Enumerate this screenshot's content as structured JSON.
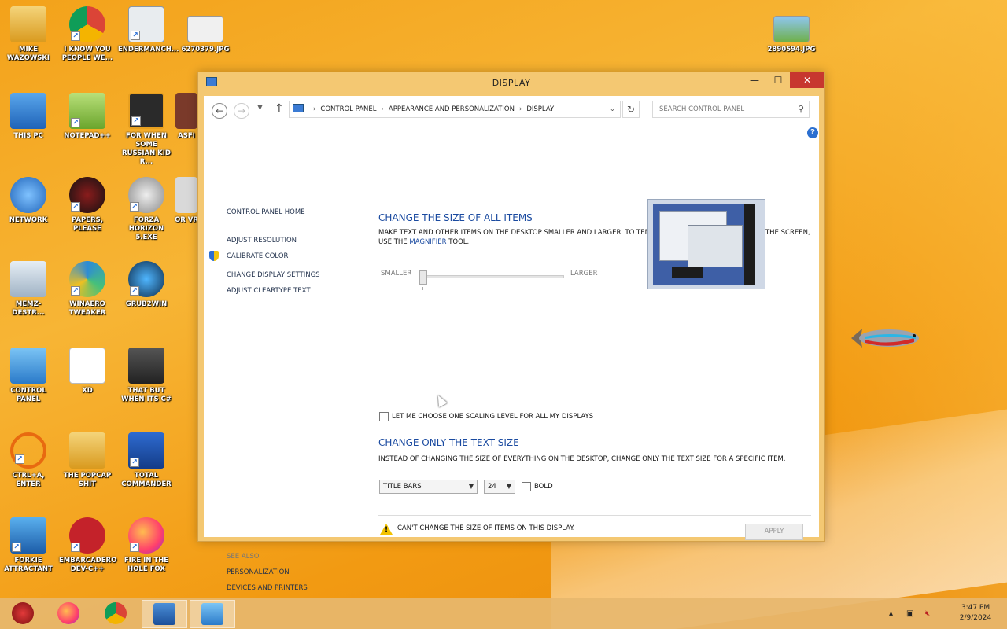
{
  "desktop": {
    "icons": [
      {
        "label": "Mike Wazowski"
      },
      {
        "label": "I know you people we..."
      },
      {
        "label": "Endermanch..."
      },
      {
        "label": "6270379.jpg"
      },
      {
        "label": "This PC"
      },
      {
        "label": "Notepad++"
      },
      {
        "label": "For when some russian kid r..."
      },
      {
        "label": "asfi"
      },
      {
        "label": "Network"
      },
      {
        "label": "Papers, Please"
      },
      {
        "label": "Forza Horizon 5.exe"
      },
      {
        "label": "or vr"
      },
      {
        "label": "MEMZ-Destr..."
      },
      {
        "label": "Winaero Tweaker"
      },
      {
        "label": "Grub2Win"
      },
      {
        "label": "Control Panel"
      },
      {
        "label": "XD"
      },
      {
        "label": "that but when its c#"
      },
      {
        "label": "ctrl+a, enter"
      },
      {
        "label": "the popcap shit"
      },
      {
        "label": "Total Commander"
      },
      {
        "label": "Forkie Attractant"
      },
      {
        "label": "Embarcadero Dev-C++"
      },
      {
        "label": "fire in the hole fox"
      },
      {
        "label": "2890594.jpg"
      }
    ]
  },
  "window": {
    "title": "Display",
    "buttons": {
      "minimize": "—",
      "maximize": "☐",
      "close": "✕"
    }
  },
  "addressbar": {
    "crumbs": [
      "Control Panel",
      "Appearance and Personalization",
      "Display"
    ],
    "search_placeholder": "Search Control Panel"
  },
  "leftnav": {
    "home": "Control Panel Home",
    "links": [
      "Adjust resolution",
      "Calibrate color",
      "Change display settings",
      "Adjust ClearType text"
    ],
    "see_also_label": "See also",
    "see_also": [
      "Personalization",
      "Devices and Printers"
    ]
  },
  "main": {
    "section1_title": "Change the size of all items",
    "section1_desc_a": "Make text and other items on the desktop smaller and larger. To temporarily enlarge just part of the screen,",
    "section1_desc_b": "use the",
    "section1_link": "Magnifier",
    "section1_desc_c": "tool.",
    "slider_smaller": "Smaller",
    "slider_larger": "Larger",
    "slider_value": 0,
    "scaling_checkbox_label": "Let me choose one scaling level for all my displays",
    "scaling_checked": false,
    "section2_title": "Change only the text size",
    "section2_desc": "Instead of changing the size of everything on the desktop, change only the text size for a specific item.",
    "item_select": "Title bars",
    "size_select": "24",
    "bold_label": "Bold",
    "bold_checked": false,
    "warning": "Can't change the size of items on this display.",
    "apply": "Apply"
  },
  "taskbar": {
    "clock_time": "3:47 PM",
    "clock_date": "2/9/2024"
  }
}
